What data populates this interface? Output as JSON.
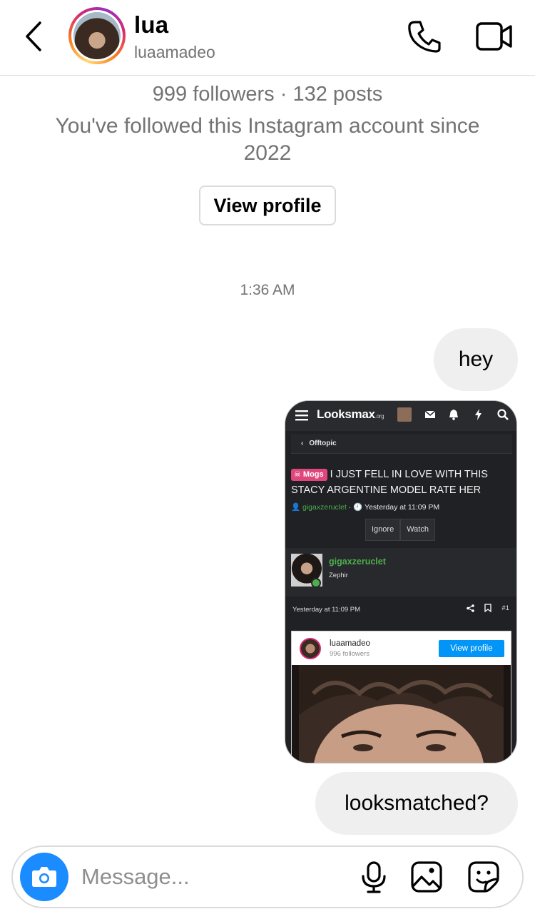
{
  "header": {
    "name": "lua",
    "username": "luaamadeo"
  },
  "profile": {
    "stats": "999 followers · 132 posts",
    "followed_since": "You've followed this Instagram account since 2022",
    "view_profile_label": "View profile"
  },
  "thread": {
    "timestamp": "1:36 AM",
    "messages": [
      "hey",
      "looksmatched?"
    ]
  },
  "shared_screenshot": {
    "site_logo": "Looksmax",
    "site_logo_suffix": ".org",
    "breadcrumb": "Offtopic",
    "tag": "Mogs",
    "thread_title": "I JUST FELL IN LOVE WITH THIS STACY ARGENTINE MODEL RATE HER",
    "author": "gigaxzeruclet",
    "posted": "Yesterday at 11:09 PM",
    "buttons": [
      "Ignore",
      "Watch"
    ],
    "post_user": "gigaxzeruclet",
    "post_rank": "Zephir",
    "post_date": "Yesterday at 11:09 PM",
    "post_number": "#1",
    "embed": {
      "username": "luaamadeo",
      "followers": "996 followers",
      "button": "View profile"
    }
  },
  "composer": {
    "placeholder": "Message..."
  },
  "icons": {
    "back": "chevron-left-icon",
    "call": "phone-icon",
    "video": "video-camera-icon",
    "camera": "camera-icon",
    "mic": "microphone-icon",
    "gallery": "image-icon",
    "sticker": "sticker-icon"
  },
  "colors": {
    "accent_blue": "#1a8cff",
    "bubble_gray": "#efefef",
    "secondary_text": "#737373",
    "looksmax_green": "#4cae4c",
    "mogs_tag": "#e0457b",
    "instagram_blue": "#0095f6"
  }
}
